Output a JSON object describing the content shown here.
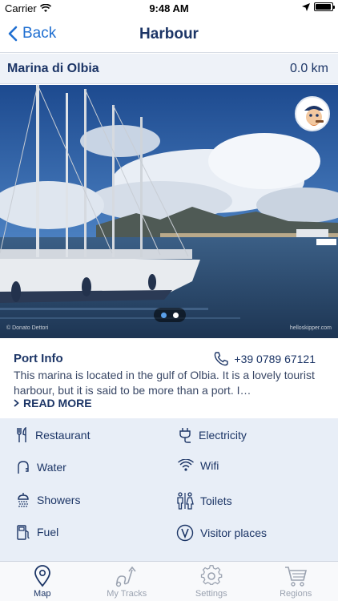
{
  "status_bar": {
    "carrier": "Carrier",
    "time": "9:48 AM",
    "battery_level": 0.95
  },
  "nav": {
    "back_label": "Back",
    "title": "Harbour"
  },
  "marina": {
    "name": "Marina di Olbia",
    "distance": "0.0 km"
  },
  "photo": {
    "credit_left": "© Donato Dettori",
    "credit_right": "helloskipper.com",
    "page_count": 2,
    "current_page": 1
  },
  "port_info": {
    "title": "Port Info",
    "phone": "+39 0789 67121",
    "description": "This marina is located in the gulf of Olbia. It is a lovely tourist harbour, but it is said to be more than a port. I…",
    "read_more": "READ MORE"
  },
  "amenities": [
    {
      "label": "Restaurant",
      "icon": "restaurant-icon"
    },
    {
      "label": "Electricity",
      "icon": "plug-icon"
    },
    {
      "label": "Water",
      "icon": "water-tap-icon"
    },
    {
      "label": "Wifi",
      "icon": "wifi-icon"
    },
    {
      "label": "Showers",
      "icon": "shower-icon"
    },
    {
      "label": "Toilets",
      "icon": "toilets-icon"
    },
    {
      "label": "Fuel",
      "icon": "fuel-icon"
    },
    {
      "label": "Visitor places",
      "icon": "visitor-places-icon"
    }
  ],
  "tabs": [
    {
      "label": "Map",
      "icon": "map-pin-icon",
      "active": true
    },
    {
      "label": "My Tracks",
      "icon": "tracks-icon",
      "active": false
    },
    {
      "label": "Settings",
      "icon": "gear-icon",
      "active": false
    },
    {
      "label": "Regions",
      "icon": "cart-icon",
      "active": false
    }
  ],
  "colors": {
    "accent": "#1f6fd1",
    "title": "#1c3566",
    "amenity_bg": "#e8eef7",
    "dot_active": "#5aa0ea"
  }
}
